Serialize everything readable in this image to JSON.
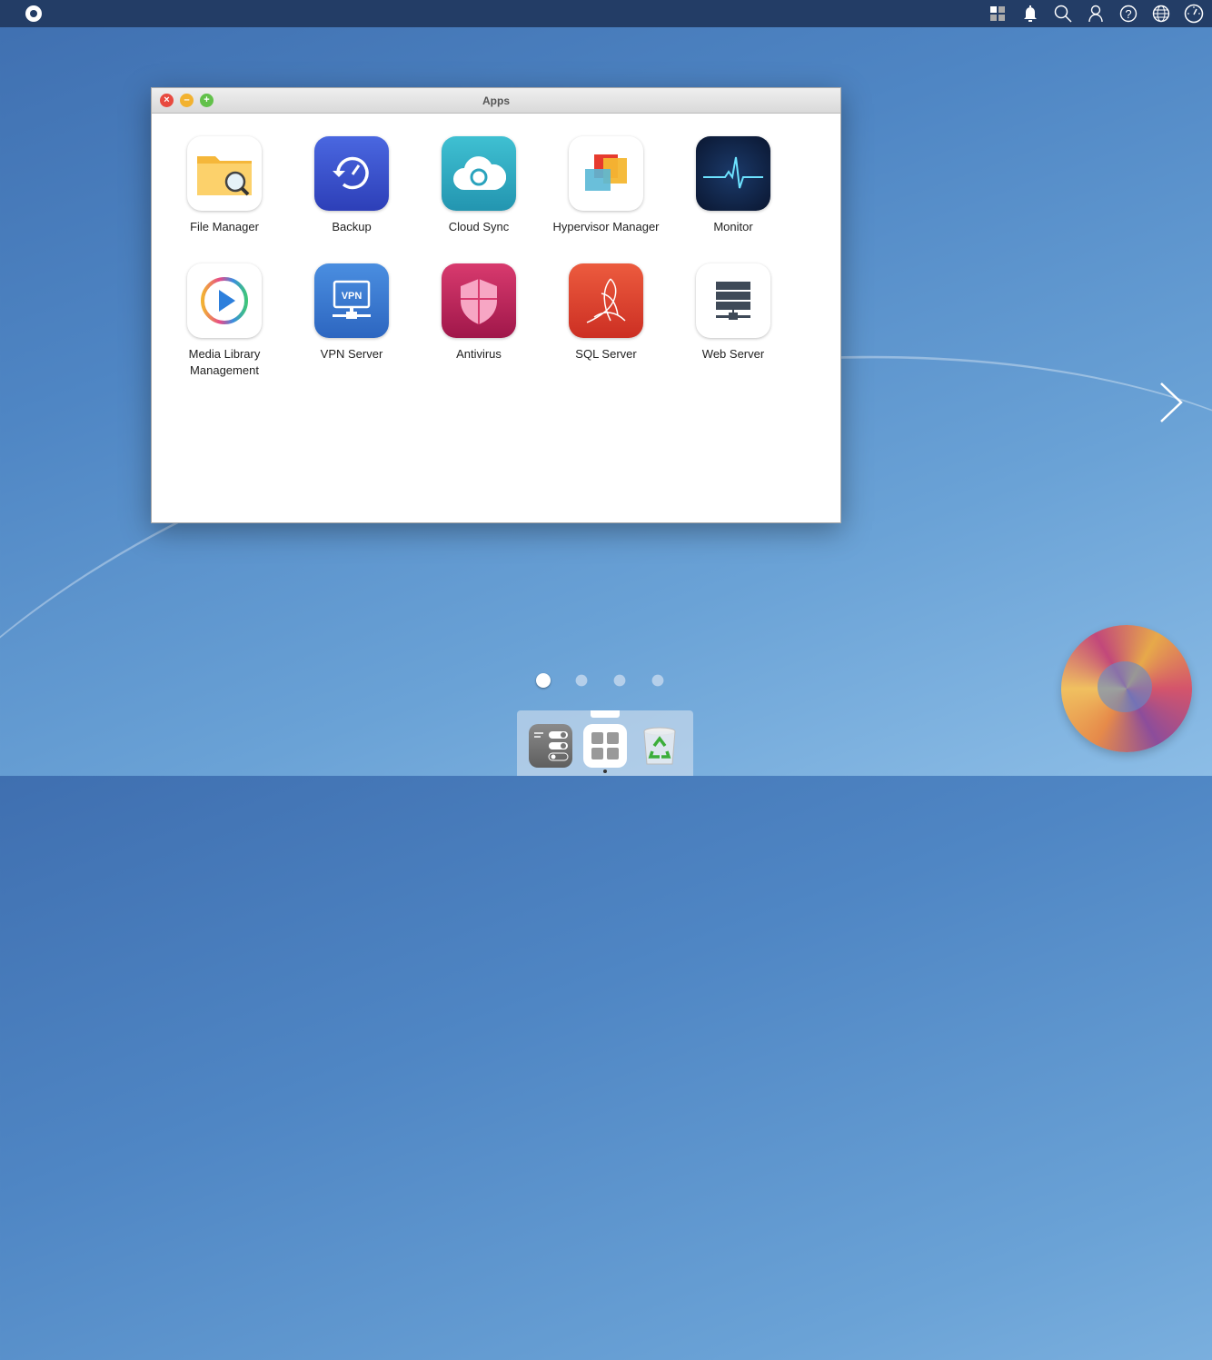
{
  "window": {
    "title": "Apps"
  },
  "apps": [
    {
      "label": "File Manager",
      "icon": "folder-search-icon"
    },
    {
      "label": "Backup",
      "icon": "backup-icon"
    },
    {
      "label": "Cloud Sync",
      "icon": "cloud-sync-icon"
    },
    {
      "label": "Hypervisor Manager",
      "icon": "hypervisor-icon"
    },
    {
      "label": "Monitor",
      "icon": "heartbeat-icon"
    },
    {
      "label": "Media Library Management",
      "icon": "play-icon"
    },
    {
      "label": "VPN Server",
      "icon": "vpn-icon",
      "badge": "VPN"
    },
    {
      "label": "Antivirus",
      "icon": "shield-icon"
    },
    {
      "label": "SQL Server",
      "icon": "sql-server-icon"
    },
    {
      "label": "Web Server",
      "icon": "server-icon"
    }
  ],
  "topbar": {
    "icons": [
      "apps-grid-icon",
      "bell-icon",
      "search-icon",
      "user-icon",
      "help-icon",
      "globe-icon",
      "dashboard-gauge-icon"
    ],
    "glyphs": {
      "help": "?"
    }
  },
  "pager": {
    "pages": 4,
    "current": 1
  }
}
